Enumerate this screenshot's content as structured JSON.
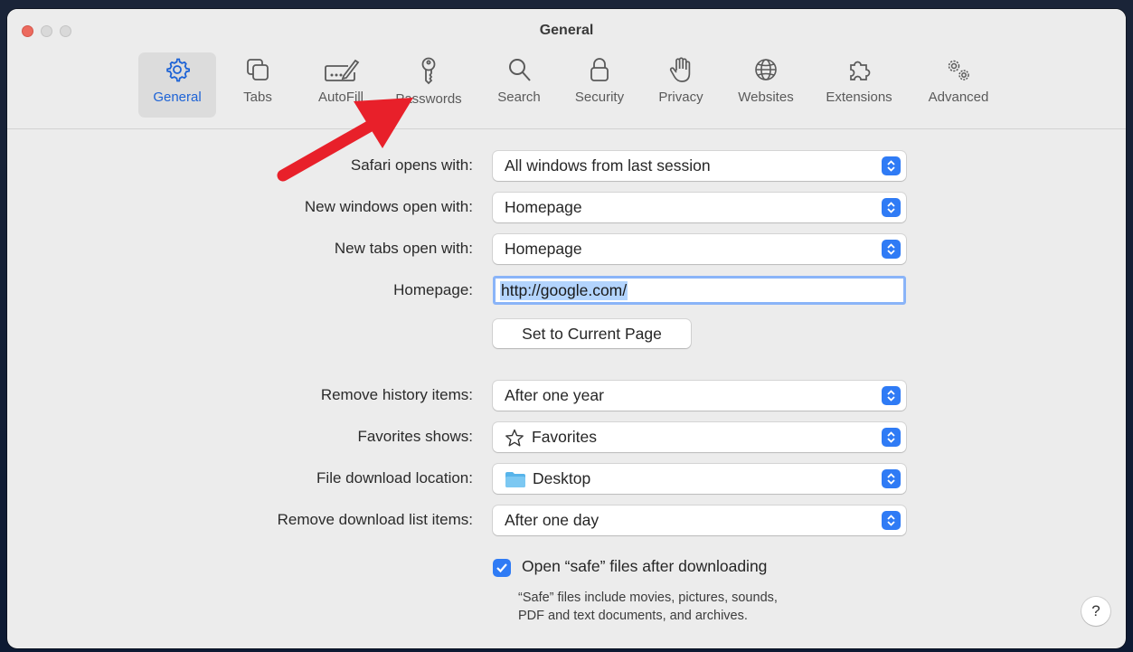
{
  "window": {
    "title": "General"
  },
  "toolbar": {
    "items": [
      {
        "label": "General",
        "icon": "gear-icon",
        "active": true
      },
      {
        "label": "Tabs",
        "icon": "tabs-icon"
      },
      {
        "label": "AutoFill",
        "icon": "pencil-form-icon"
      },
      {
        "label": "Passwords",
        "icon": "key-icon"
      },
      {
        "label": "Search",
        "icon": "magnifier-icon"
      },
      {
        "label": "Security",
        "icon": "lock-icon"
      },
      {
        "label": "Privacy",
        "icon": "hand-icon"
      },
      {
        "label": "Websites",
        "icon": "globe-icon"
      },
      {
        "label": "Extensions",
        "icon": "puzzle-icon"
      },
      {
        "label": "Advanced",
        "icon": "gears-icon"
      }
    ]
  },
  "settings": {
    "safari_opens_with": {
      "label": "Safari opens with:",
      "value": "All windows from last session"
    },
    "new_windows": {
      "label": "New windows open with:",
      "value": "Homepage"
    },
    "new_tabs": {
      "label": "New tabs open with:",
      "value": "Homepage"
    },
    "homepage": {
      "label": "Homepage:",
      "value": "http://google.com/"
    },
    "set_current_page": "Set to Current Page",
    "remove_history": {
      "label": "Remove history items:",
      "value": "After one year"
    },
    "favorites_shows": {
      "label": "Favorites shows:",
      "value": "Favorites",
      "icon": "star-icon"
    },
    "download_location": {
      "label": "File download location:",
      "value": "Desktop",
      "icon": "folder-icon"
    },
    "remove_download": {
      "label": "Remove download list items:",
      "value": "After one day"
    },
    "open_safe_files": {
      "label": "Open “safe” files after downloading",
      "checked": true
    },
    "safe_help_line1": "“Safe” files include movies, pictures, sounds,",
    "safe_help_line2": "PDF and text documents, and archives."
  },
  "help_button": "?",
  "colors": {
    "accent": "#2f7bf5",
    "arrow": "#e8202a",
    "close": "#ec6a5e"
  }
}
